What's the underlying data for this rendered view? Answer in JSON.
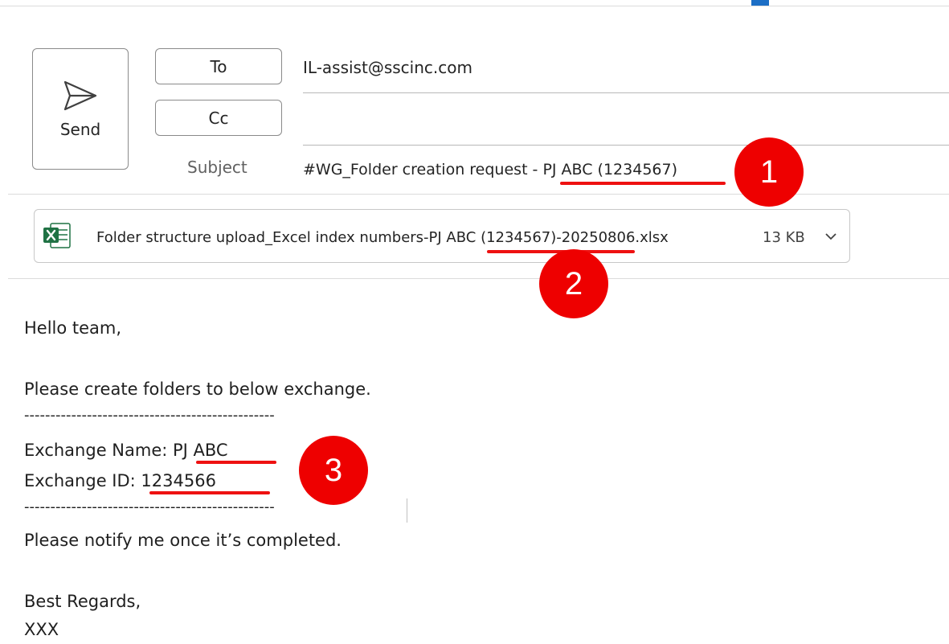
{
  "compose": {
    "send_label": "Send",
    "to_label": "To",
    "cc_label": "Cc",
    "subject_label": "Subject",
    "to_value": "IL-assist@sscinc.com",
    "cc_value": "",
    "subject_value": "#WG_Folder creation request - PJ ABC (1234567)"
  },
  "attachment": {
    "icon": "excel-icon",
    "filename": "Folder structure upload_Excel index numbers-PJ ABC (1234567)-20250806.xlsx",
    "size": "13 KB"
  },
  "body": {
    "greeting": "Hello team,",
    "line1": "Please create folders to below exchange.",
    "separator": "------------------------------------------------",
    "exchange_name": "Exchange Name: PJ ABC",
    "exchange_id": "Exchange ID: 1234566",
    "line2": "Please notify me once it’s completed.",
    "closing": "Best Regards,",
    "signature": "XXX"
  },
  "annotations": {
    "color": "#ee0000",
    "badges": [
      "1",
      "2",
      "3"
    ]
  }
}
